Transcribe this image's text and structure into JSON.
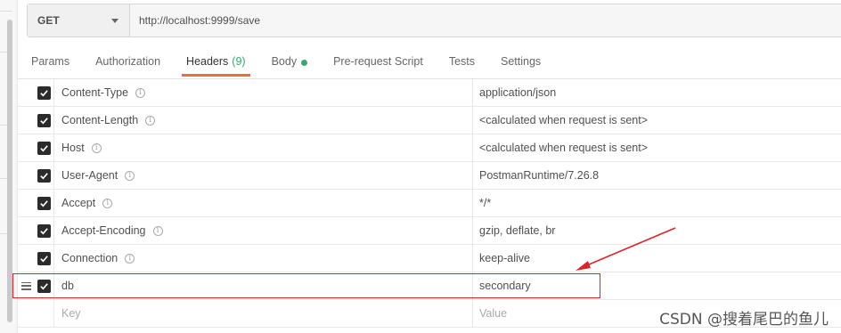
{
  "request": {
    "method": "GET",
    "url": "http://localhost:9999/save"
  },
  "tabs": [
    {
      "label": "Params",
      "active": false
    },
    {
      "label": "Authorization",
      "active": false
    },
    {
      "label": "Headers",
      "count": "(9)",
      "active": true
    },
    {
      "label": "Body",
      "has_dot": true,
      "active": false
    },
    {
      "label": "Pre-request Script",
      "active": false
    },
    {
      "label": "Tests",
      "active": false
    },
    {
      "label": "Settings",
      "active": false
    }
  ],
  "headers": [
    {
      "key": "Content-Type",
      "value": "application/json",
      "checked": true,
      "info": true
    },
    {
      "key": "Content-Length",
      "value": "<calculated when request is sent>",
      "checked": true,
      "info": true
    },
    {
      "key": "Host",
      "value": "<calculated when request is sent>",
      "checked": true,
      "info": true
    },
    {
      "key": "User-Agent",
      "value": "PostmanRuntime/7.26.8",
      "checked": true,
      "info": true
    },
    {
      "key": "Accept",
      "value": "*/*",
      "checked": true,
      "info": true
    },
    {
      "key": "Accept-Encoding",
      "value": "gzip, deflate, br",
      "checked": true,
      "info": true
    },
    {
      "key": "Connection",
      "value": "keep-alive",
      "checked": true,
      "info": true
    },
    {
      "key": "db",
      "value": "secondary",
      "checked": true,
      "info": false
    }
  ],
  "new_row": {
    "key_placeholder": "Key",
    "value_placeholder": "Value"
  },
  "info_glyph": "i",
  "watermark": "CSDN @搜着尾巴的鱼儿",
  "colors": {
    "accent_tab": "#f26b3a",
    "green": "#38a86b",
    "annotation_red": "#d9252b"
  }
}
